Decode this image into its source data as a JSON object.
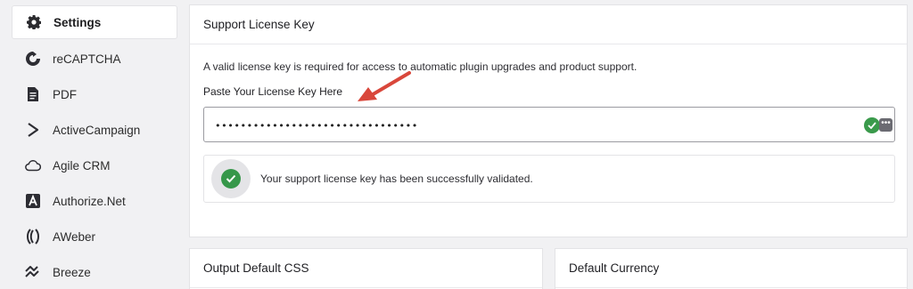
{
  "sidebar": {
    "items": [
      {
        "label": "Settings",
        "icon": "gear-icon",
        "active": true
      },
      {
        "label": "reCAPTCHA",
        "icon": "recaptcha-icon"
      },
      {
        "label": "PDF",
        "icon": "pdf-icon"
      },
      {
        "label": "ActiveCampaign",
        "icon": "activecampaign-icon"
      },
      {
        "label": "Agile CRM",
        "icon": "cloud-icon"
      },
      {
        "label": "Authorize.Net",
        "icon": "authorize-net-icon"
      },
      {
        "label": "AWeber",
        "icon": "aweber-icon"
      },
      {
        "label": "Breeze",
        "icon": "breeze-icon"
      }
    ]
  },
  "license_panel": {
    "title": "Support License Key",
    "description": "A valid license key is required for access to automatic plugin upgrades and product support.",
    "field_label": "Paste Your License Key Here",
    "field_value": "••••••••••••••••••••••••••••••••",
    "success_message": "Your support license key has been successfully validated."
  },
  "css_panel": {
    "title": "Output Default CSS"
  },
  "currency_panel": {
    "title": "Default Currency"
  },
  "colors": {
    "success": "#36974a",
    "annotation_arrow": "#d9473b"
  }
}
